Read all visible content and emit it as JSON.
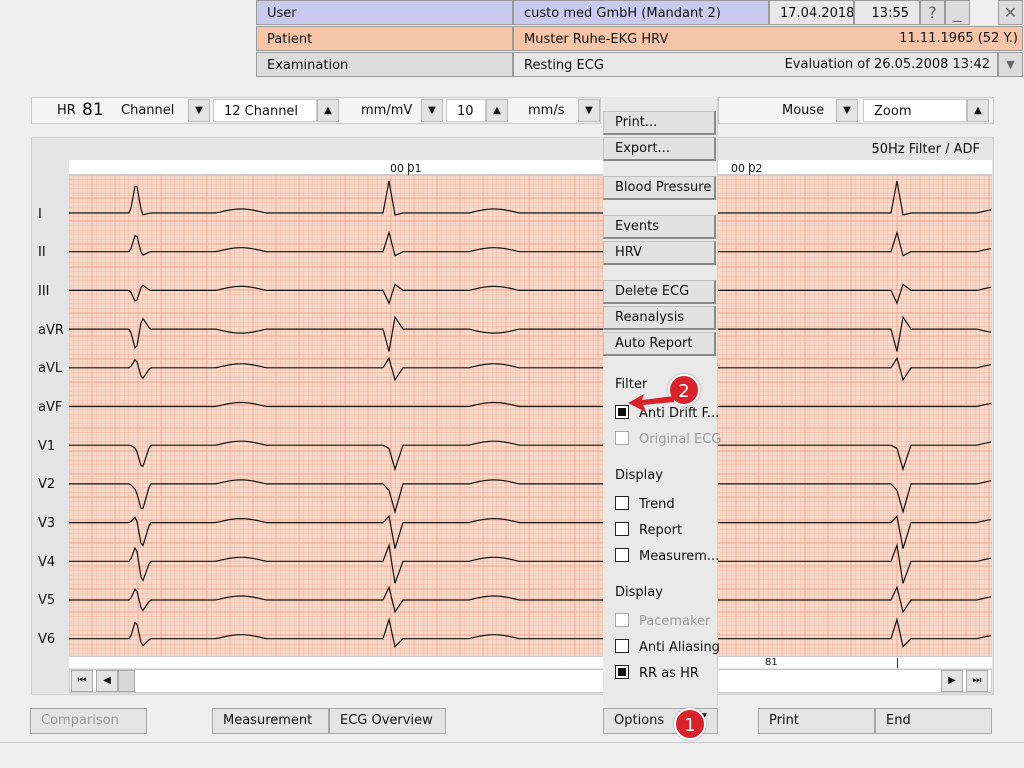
{
  "header": {
    "user_label": "User",
    "user_value": "custo med GmbH (Mandant 2)",
    "date": "17.04.2018",
    "time": "13:55",
    "help": "?",
    "minimize": "_",
    "close": "✕",
    "patient_label": "Patient",
    "patient_name": "Muster Ruhe-EKG HRV",
    "patient_dob": "11.11.1965 (52 Y.)",
    "exam_label": "Examination",
    "exam_value": "Resting ECG",
    "evaluation": "Evaluation of  26.05.2008 13:42",
    "dropdown": "▼"
  },
  "toolbar": {
    "hr_label": "HR",
    "hr_value": "81",
    "channel_label": "Channel",
    "channel_value": "12 Channel",
    "mmmv_label": "mm/mV",
    "speed_value": "10",
    "mms_label": "mm/s",
    "mouse_label": "Mouse",
    "mouse_value": "Zoom"
  },
  "ecg": {
    "filter_text": "50Hz Filter / ADF",
    "time_markers": [
      "00 01",
      "00 02"
    ],
    "leads": [
      "I",
      "II",
      "III",
      "aVR",
      "aVL",
      "aVF",
      "V1",
      "V2",
      "V3",
      "V4",
      "V5",
      "V6"
    ],
    "rr_value": "81",
    "grid_color": "#f7d8c8",
    "grid_line_color": "#f0a890"
  },
  "options_menu": {
    "print": "Print...",
    "export": "Export...",
    "blood_pressure": "Blood Pressure",
    "events": "Events",
    "hrv": "HRV",
    "delete_ecg": "Delete ECG",
    "reanalysis": "Reanalysis",
    "auto_report": "Auto Report",
    "filter_heading": "Filter",
    "anti_drift": "Anti Drift F...",
    "original_ecg": "Original ECG",
    "display_heading_1": "Display",
    "trend": "Trend",
    "report": "Report",
    "measurem": "Measurem...",
    "display_heading_2": "Display",
    "pacemaker": "Pacemaker",
    "anti_aliasing": "Anti Aliasing",
    "rr_as_hr": "RR as HR"
  },
  "bottom": {
    "comparison": "Comparison",
    "measurement": "Measurement",
    "ecg_overview": "ECG Overview",
    "options": "Options",
    "print": "Print",
    "end": "End"
  },
  "badges": {
    "one": "1",
    "two": "2"
  },
  "colors": {
    "badge_red": "#d9222a",
    "user_row": "#c9cbee",
    "patient_row": "#f6c4a6"
  }
}
